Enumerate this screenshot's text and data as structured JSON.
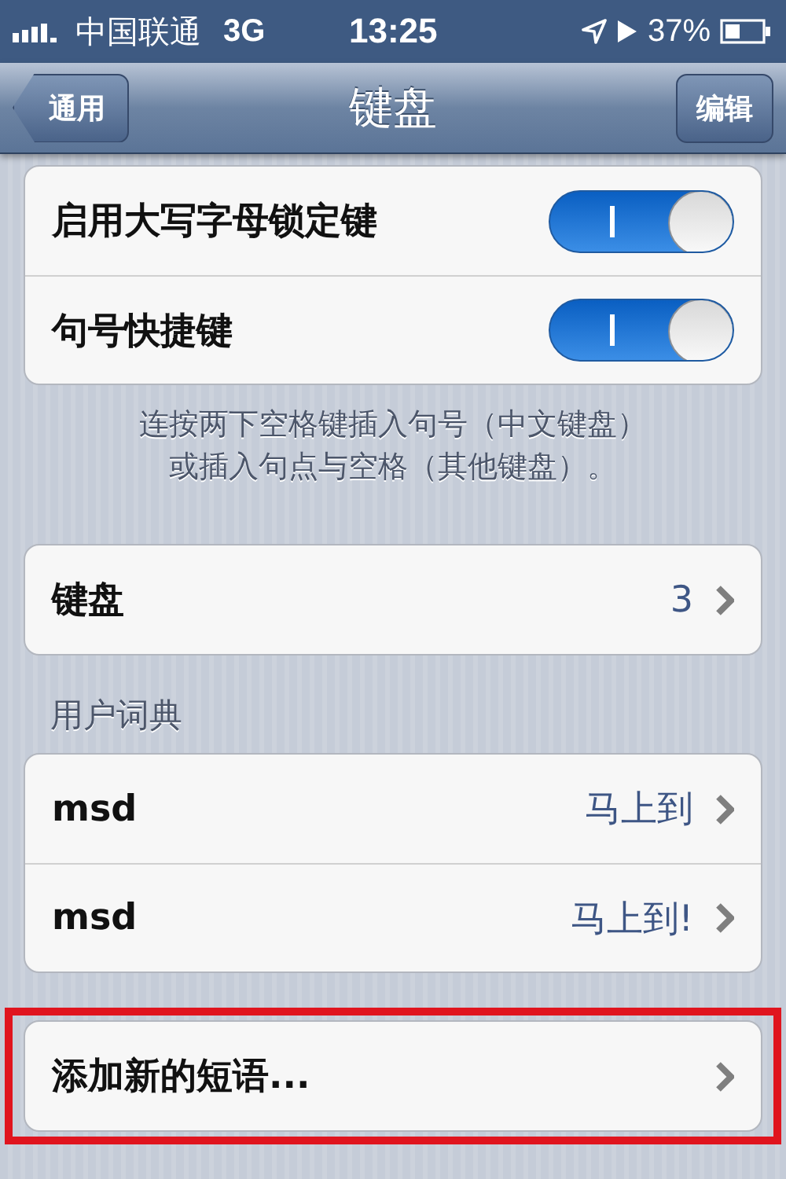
{
  "status_bar": {
    "carrier": "中国联通",
    "network": "3G",
    "time": "13:25",
    "battery": "37%"
  },
  "nav_bar": {
    "back": "通用",
    "title": "键盘",
    "action": "编辑"
  },
  "sections": [
    {
      "rows": [
        {
          "kind": "switch",
          "label": "启用大写字母锁定键",
          "on": true
        },
        {
          "kind": "switch",
          "label": "句号快捷键",
          "on": true
        }
      ],
      "footer": [
        "连按两下空格键插入句号（中文键盘）",
        "或插入句点与空格（其他键盘）。"
      ]
    },
    {
      "rows": [
        {
          "kind": "link",
          "label": "键盘",
          "value": "3"
        }
      ]
    },
    {
      "header": "用户词典",
      "rows": [
        {
          "kind": "link",
          "label": "msd",
          "value": "马上到"
        },
        {
          "kind": "link",
          "label": "msd",
          "value": "马上到!"
        }
      ]
    },
    {
      "rows": [
        {
          "kind": "link",
          "label": "添加新的短语..."
        }
      ],
      "highlighted": true
    }
  ]
}
